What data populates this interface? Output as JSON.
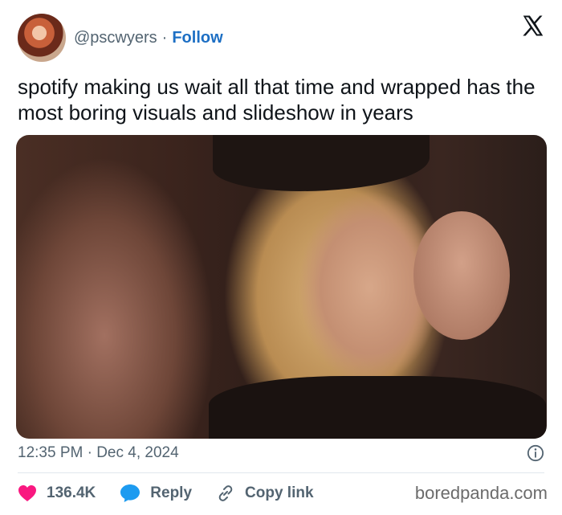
{
  "user": {
    "handle": "@pscwyers",
    "separator": "·",
    "follow_label": "Follow"
  },
  "tweet": {
    "text": "spotify making us wait all that time and wrapped has the most boring visuals and slideshow in years",
    "timestamp": "12:35 PM · Dec 4, 2024"
  },
  "actions": {
    "likes": "136.4K",
    "reply_label": "Reply",
    "copy_label": "Copy link"
  },
  "watermark": "boredpanda.com",
  "colors": {
    "accent": "#1d6fc4",
    "like": "#f91880",
    "reply": "#1d9bf0",
    "muted": "#536471"
  },
  "icons": [
    "x-logo-icon",
    "info-icon",
    "heart-icon",
    "reply-bubble-icon",
    "link-icon"
  ]
}
